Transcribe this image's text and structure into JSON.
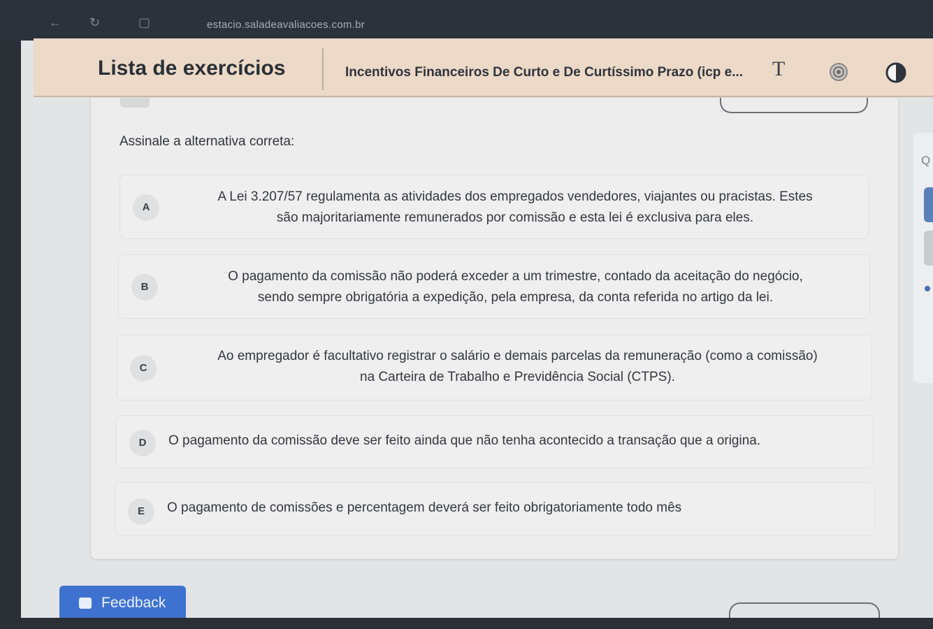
{
  "browser": {
    "url": "estacio.saladeavaliacoes.com.br"
  },
  "header": {
    "title": "Lista de exercícios",
    "subtitle": "Incentivos Financeiros De Curto e De Curtíssimo Prazo (icp e...",
    "font_icon_glyph": "T",
    "icons": [
      "font-size-icon",
      "target-icon",
      "contrast-icon"
    ]
  },
  "question": {
    "prompt": "Assinale a alternativa correta:",
    "options": [
      {
        "letter": "A",
        "line1": "A Lei 3.207/57 regulamenta as atividades dos empregados vendedores, viajantes ou pracistas. Estes",
        "line2": "são majoritariamente remunerados por comissão e esta lei é exclusiva para eles."
      },
      {
        "letter": "B",
        "line1": "O pagamento da comissão não poderá exceder a um trimestre, contado da aceitação do negócio,",
        "line2": "sendo sempre obrigatória a expedição, pela empresa, da conta referida no artigo da lei."
      },
      {
        "letter": "C",
        "line1": "Ao empregador é facultativo registrar o salário e demais parcelas da remuneração (como a comissão)",
        "line2": "na Carteira de Trabalho e Previdência Social (CTPS)."
      },
      {
        "letter": "D",
        "line1": "O pagamento da comissão deve ser feito ainda que não tenha acontecido a transação que a origina."
      },
      {
        "letter": "E",
        "line1": "O pagamento de comissões e percentagem deverá ser feito obrigatoriamente todo mês"
      }
    ]
  },
  "side_panel": {
    "label": "Q"
  },
  "feedback": {
    "label": "Feedback"
  },
  "colors": {
    "header_bg": "#ecd9c7",
    "accent_blue": "#3f72d0"
  }
}
